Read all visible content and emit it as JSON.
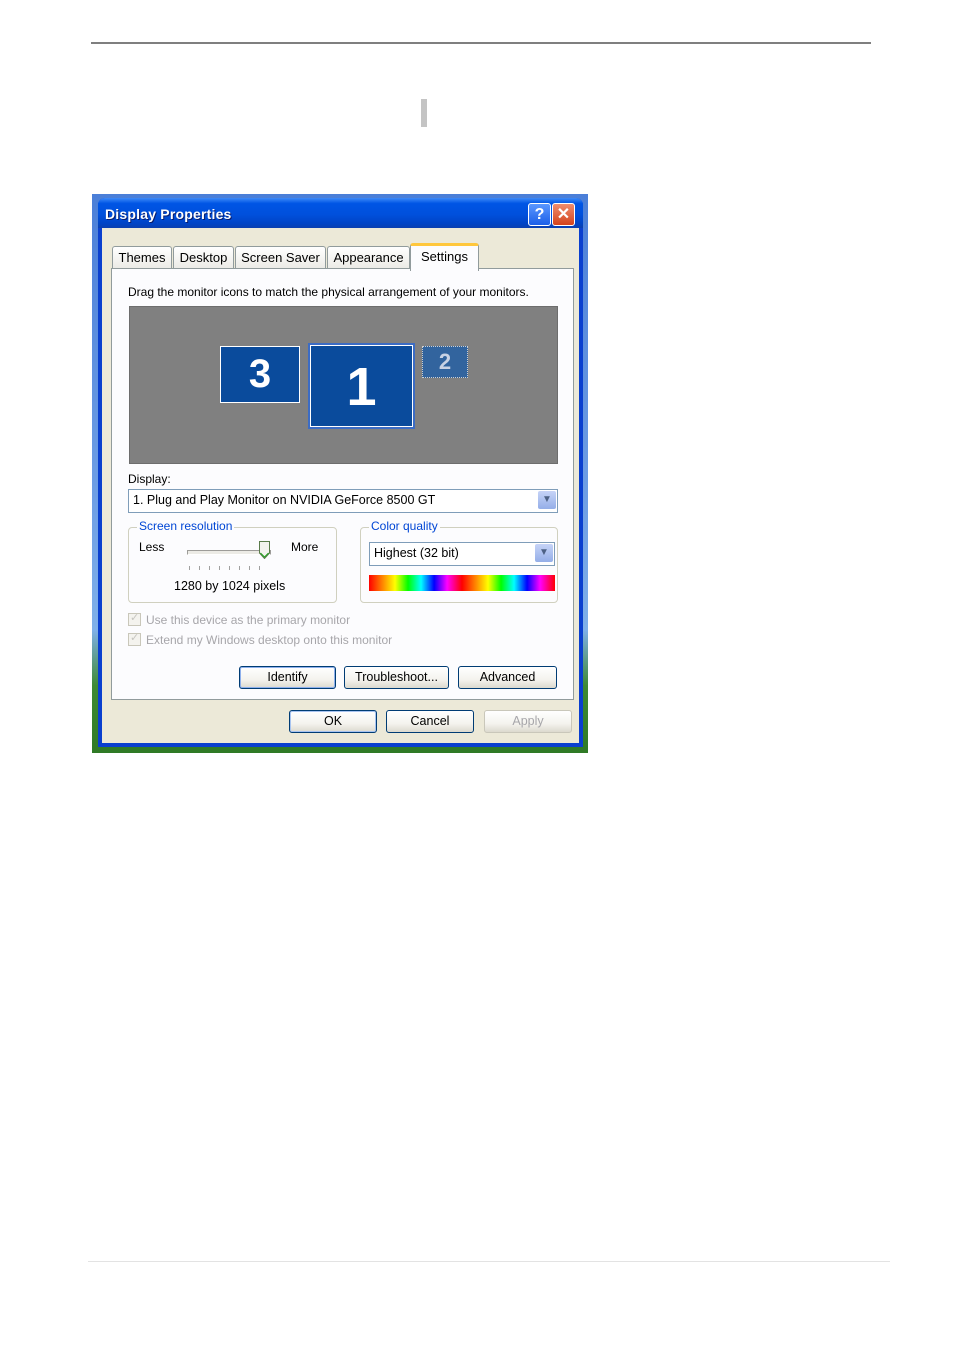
{
  "dialog": {
    "title": "Display Properties",
    "help_glyph": "?",
    "close_glyph": "✕"
  },
  "tabs": [
    {
      "label": "Themes"
    },
    {
      "label": "Desktop"
    },
    {
      "label": "Screen Saver"
    },
    {
      "label": "Appearance"
    },
    {
      "label": "Settings"
    }
  ],
  "active_tab": "Settings",
  "settings": {
    "instruction": "Drag the monitor icons to match the physical arrangement of your monitors.",
    "monitors": [
      {
        "number": "3"
      },
      {
        "number": "1"
      },
      {
        "number": "2"
      }
    ],
    "selected_monitor": "1",
    "display_label": "Display:",
    "display_value": "1. Plug and Play Monitor on NVIDIA GeForce 8500 GT",
    "screen_resolution": {
      "legend": "Screen resolution",
      "less_label": "Less",
      "more_label": "More",
      "value_text": "1280 by 1024 pixels",
      "slider_level": 1.0
    },
    "color_quality": {
      "legend": "Color quality",
      "value": "Highest (32 bit)"
    },
    "checkboxes": [
      {
        "label": "Use this device as the primary monitor",
        "checked": true,
        "enabled": false
      },
      {
        "label": "Extend my Windows desktop onto this monitor",
        "checked": true,
        "enabled": false
      }
    ],
    "buttons": {
      "identify": "Identify",
      "troubleshoot": "Troubleshoot...",
      "advanced": "Advanced"
    }
  },
  "footer_buttons": {
    "ok": "OK",
    "cancel": "Cancel",
    "apply": "Apply"
  },
  "colors": {
    "title_bar": "#0055e5",
    "monitor_fill": "#0a4b9c",
    "monitor_area": "#808080",
    "active_tab_accent": "#ffc73c",
    "group_legend": "#0046d5"
  },
  "icons": {
    "help": "help-icon",
    "close": "close-icon",
    "dropdown": "chevron-down-icon",
    "check": "check-icon"
  }
}
